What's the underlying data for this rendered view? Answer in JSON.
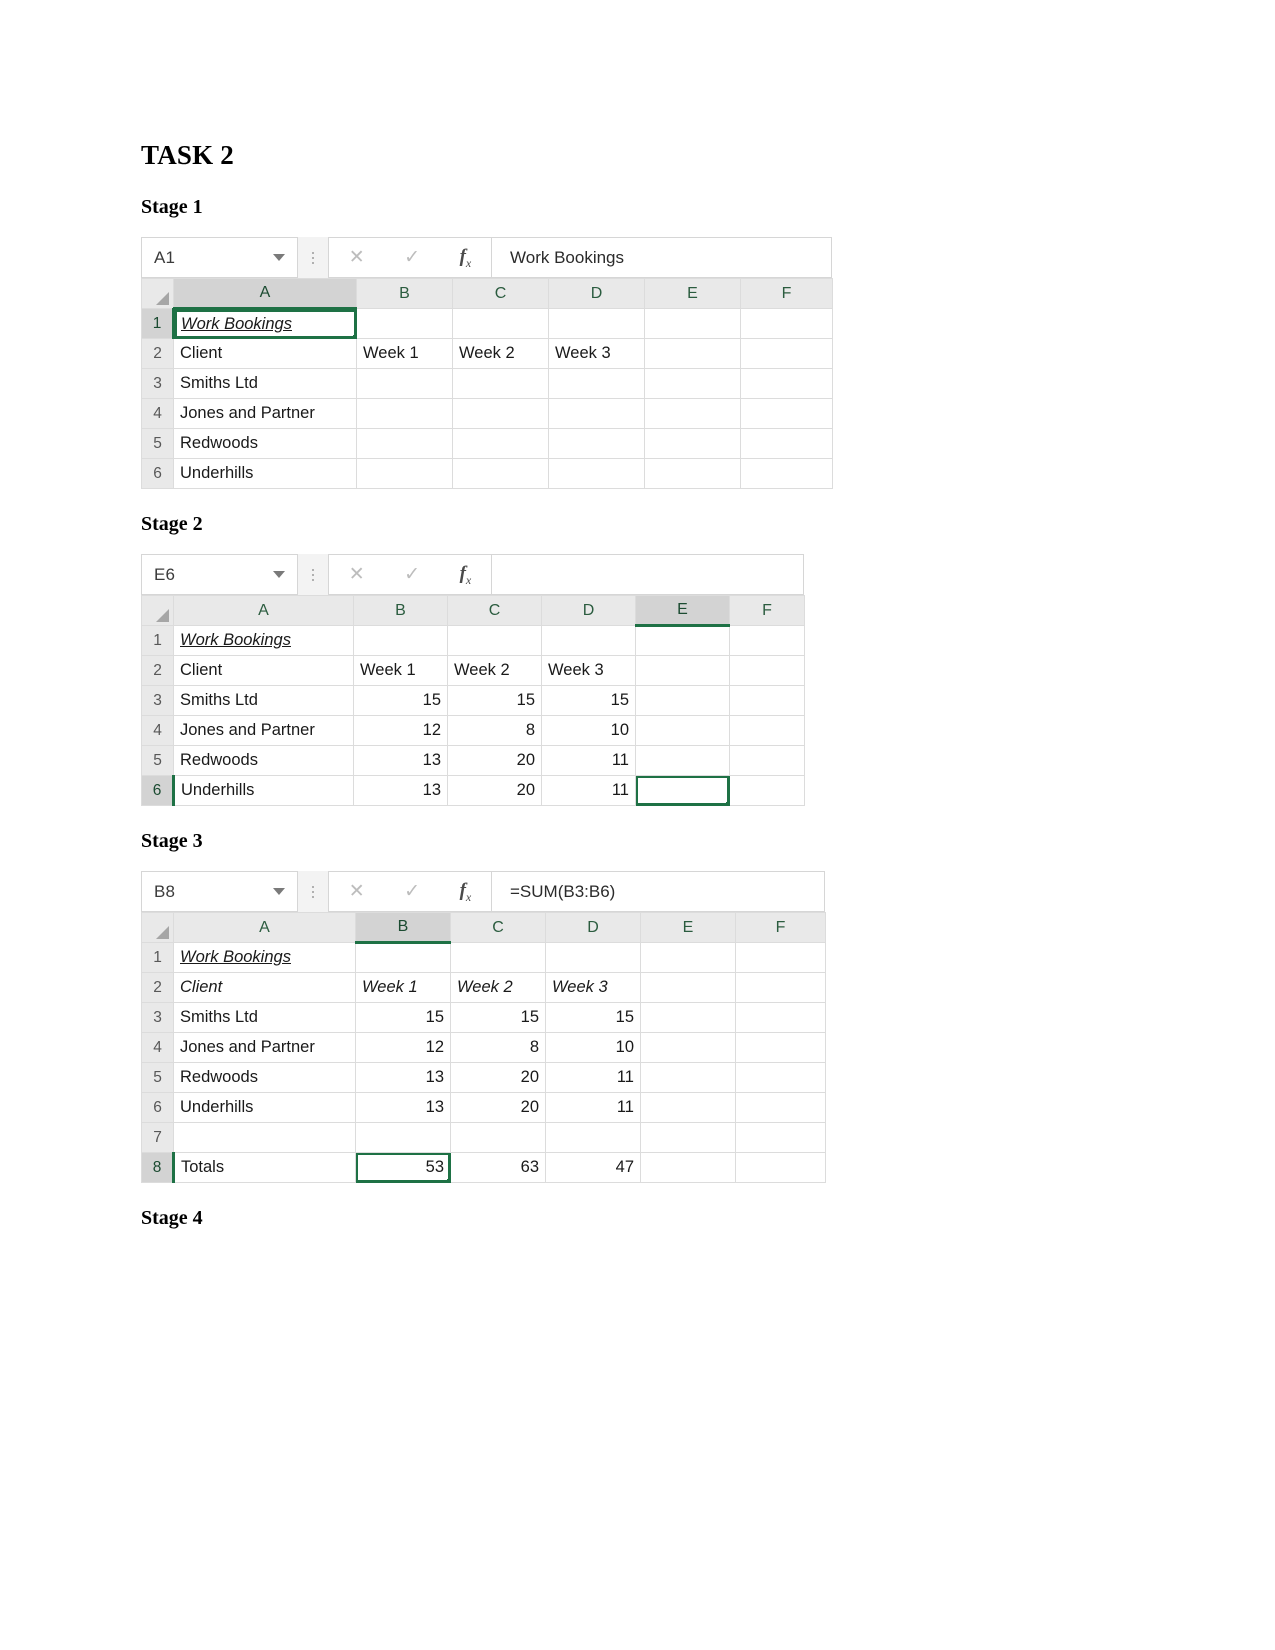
{
  "document": {
    "title": "TASK 2",
    "stages": [
      {
        "heading": "Stage 1"
      },
      {
        "heading": "Stage 2"
      },
      {
        "heading": "Stage 3"
      },
      {
        "heading": "Stage 4"
      }
    ]
  },
  "colors": {
    "excel_green": "#1e7145",
    "header_gray": "#e9e9e9",
    "selected_header_gray": "#d3d3d3",
    "gridline": "#dcdcdc"
  },
  "icons": {
    "cancel": "✕",
    "confirm": "✓",
    "function": "fx",
    "dropdown": "caret-down"
  },
  "stage1": {
    "name_box": "A1",
    "formula_bar": "Work Bookings",
    "columns": [
      "A",
      "B",
      "C",
      "D",
      "E",
      "F"
    ],
    "rows": [
      "1",
      "2",
      "3",
      "4",
      "5",
      "6"
    ],
    "selected_cell": "A1",
    "selected_column": "A",
    "selected_row": "1",
    "data": [
      [
        "Work Bookings",
        "",
        "",
        "",
        "",
        ""
      ],
      [
        "Client",
        "Week 1",
        "Week 2",
        "Week 3",
        "",
        ""
      ],
      [
        "Smiths Ltd",
        "",
        "",
        "",
        "",
        ""
      ],
      [
        "Jones and Partner",
        "",
        "",
        "",
        "",
        ""
      ],
      [
        "Redwoods",
        "",
        "",
        "",
        "",
        ""
      ],
      [
        "Underhills",
        "",
        "",
        "",
        "",
        ""
      ]
    ]
  },
  "stage2": {
    "name_box": "E6",
    "formula_bar": "",
    "columns": [
      "A",
      "B",
      "C",
      "D",
      "E",
      "F"
    ],
    "rows": [
      "1",
      "2",
      "3",
      "4",
      "5",
      "6"
    ],
    "selected_cell": "E6",
    "selected_column": "E",
    "selected_row": "6",
    "data": [
      [
        "Work Bookings",
        "",
        "",
        "",
        "",
        ""
      ],
      [
        "Client",
        "Week 1",
        "Week 2",
        "Week 3",
        "",
        ""
      ],
      [
        "Smiths Ltd",
        "15",
        "15",
        "15",
        "",
        ""
      ],
      [
        "Jones and Partner",
        "12",
        "8",
        "10",
        "",
        ""
      ],
      [
        "Redwoods",
        "13",
        "20",
        "11",
        "",
        ""
      ],
      [
        "Underhills",
        "13",
        "20",
        "11",
        "",
        ""
      ]
    ]
  },
  "stage3": {
    "name_box": "B8",
    "formula_bar": "=SUM(B3:B6)",
    "columns": [
      "A",
      "B",
      "C",
      "D",
      "E",
      "F"
    ],
    "rows": [
      "1",
      "2",
      "3",
      "4",
      "5",
      "6",
      "7",
      "8"
    ],
    "selected_cell": "B8",
    "selected_column": "B",
    "selected_row": "8",
    "data": [
      [
        "Work Bookings",
        "",
        "",
        "",
        "",
        ""
      ],
      [
        "Client",
        "Week 1",
        "Week 2",
        "Week 3",
        "",
        ""
      ],
      [
        "Smiths Ltd",
        "15",
        "15",
        "15",
        "",
        ""
      ],
      [
        "Jones and Partner",
        "12",
        "8",
        "10",
        "",
        ""
      ],
      [
        "Redwoods",
        "13",
        "20",
        "11",
        "",
        ""
      ],
      [
        "Underhills",
        "13",
        "20",
        "11",
        "",
        ""
      ],
      [
        "",
        "",
        "",
        "",
        "",
        ""
      ],
      [
        "Totals",
        "53",
        "63",
        "47",
        "",
        ""
      ]
    ]
  }
}
